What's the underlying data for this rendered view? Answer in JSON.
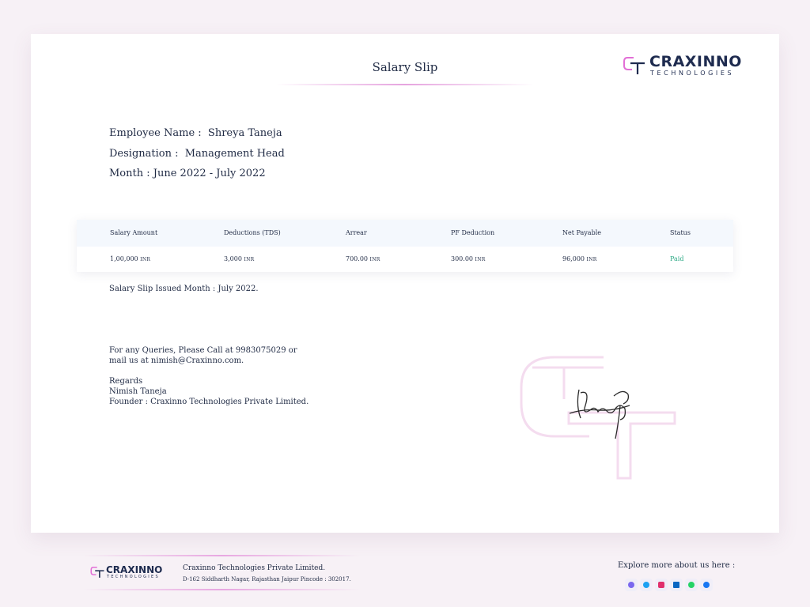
{
  "document": {
    "title": "Salary Slip",
    "logo": {
      "brand": "CRAXINNO",
      "sub": "TECHNOLOGIES"
    },
    "employee": {
      "name_label": "Employee Name :",
      "name": "Shreya Taneja",
      "designation_label": "Designation :",
      "designation": "Management Head",
      "month_label": "Month :",
      "month": "June 2022 - July 2022"
    },
    "table": {
      "headers": [
        "Salary Amount",
        "Deductions (TDS)",
        "Arrear",
        "PF Deduction",
        "Net Payable",
        "Status"
      ],
      "row": {
        "salary": "1,00,000",
        "deductions": "3,000",
        "arrear": "700.00",
        "pf": "300.00",
        "net": "96,000",
        "unit": "INR",
        "status": "Paid"
      }
    },
    "issued": "Salary Slip Issued Month : July 2022.",
    "queries": "For any Queries, Please Call at 9983075029 or mail us at nimish@Craxinno.com.",
    "regards": {
      "line1": "Regards",
      "line2": "Nimish Taneja",
      "line3": "Founder : Craxinno Technologies Private Limited."
    }
  },
  "footer": {
    "logo": {
      "brand": "CRAXINNO",
      "sub": "TECHNOLOGIES"
    },
    "company": "Craxinno Technologies Private Limited.",
    "address": "D-162 Siddharth Nagar, Rajasthan Jaipur Pincode : 302017.",
    "explore": "Explore more about us here :",
    "socials": [
      {
        "icon": "globe-icon",
        "color": "#7b68ee"
      },
      {
        "icon": "skype-icon",
        "color": "#1da1f2"
      },
      {
        "icon": "instagram-icon",
        "color": "#e1306c"
      },
      {
        "icon": "linkedin-icon",
        "color": "#0a66c2"
      },
      {
        "icon": "whatsapp-icon",
        "color": "#25d366"
      },
      {
        "icon": "facebook-icon",
        "color": "#1877f2"
      }
    ]
  },
  "colors": {
    "accent": "#e6a4df",
    "text": "#1f2a44",
    "status_paid": "#2eaa86",
    "table_header": "#f4f8fd",
    "page_bg": "#f7f1f6"
  }
}
